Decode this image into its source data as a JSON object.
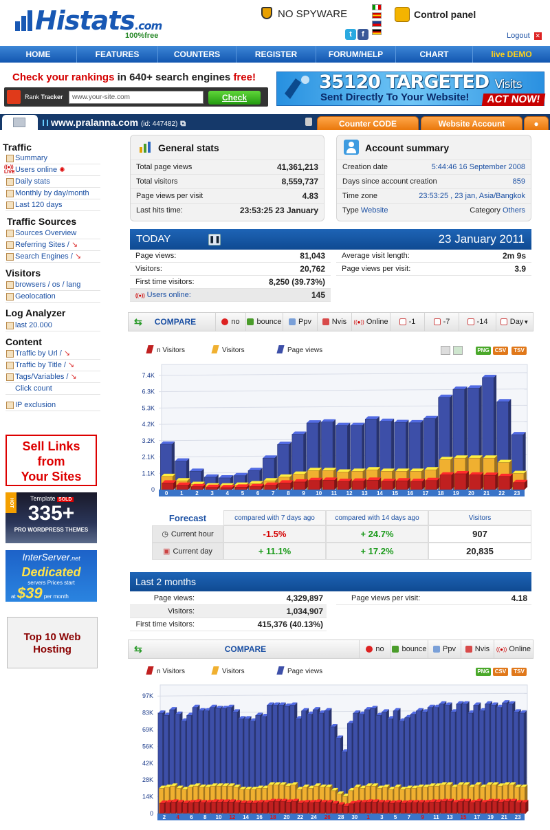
{
  "header": {
    "logo_text": "Histats",
    "logo_suffix": ".com",
    "logo_tagline": "100%free",
    "nospyware": "NO SPYWARE",
    "control_panel": "Control panel",
    "logout": "Logout"
  },
  "nav": [
    "HOME",
    "FEATURES",
    "COUNTERS",
    "REGISTER",
    "FORUM/HELP",
    "CHART",
    "live DEMO"
  ],
  "rank": {
    "headline_a": "Check your rankings",
    "headline_b": "in 640+ search engines",
    "headline_c": "free!",
    "label_a": "Rank",
    "label_b": "Tracker",
    "input_value": "www.your-site.com",
    "button": "Check"
  },
  "banner": {
    "line1_num": "35120 TARGETED",
    "line1_suffix": "Visits",
    "line2": "Sent Directly To Your Website!",
    "cta": "ACT NOW!"
  },
  "sitebar": {
    "site": "www.pralanna.com",
    "id_text": "(id: 447482)",
    "tab_counter": "Counter CODE",
    "tab_account": "Website Account"
  },
  "sidebar": {
    "traffic_title": "Traffic",
    "traffic_items": [
      "Summary",
      "Users online",
      "Daily stats",
      "Monthly by day/month",
      "Last 120 days"
    ],
    "sources_title": "Traffic Sources",
    "sources_items": [
      "Sources Overview",
      "Referring Sites /",
      "Search Engines /"
    ],
    "visitors_title": "Visitors",
    "visitors_items": [
      "browsers / os / lang",
      "Geolocation"
    ],
    "log_title": "Log Analyzer",
    "log_items": [
      "last 20.000"
    ],
    "content_title": "Content",
    "content_items": [
      "Traffic by Url /",
      "Traffic by Title /",
      "Tags/Variables /",
      "Click count"
    ],
    "ip_exclusion": "IP exclusion"
  },
  "ads": {
    "sell1": "Sell Links",
    "sell2": "from",
    "sell3": "Your Sites",
    "template_word": "Template",
    "sold_badge": "SOLD",
    "hot_badge": "HOT",
    "num335": "335+",
    "pro_wp": "PRO WORDPRESS THEMES",
    "interserver": "InterServer",
    "interserver_tld": ".net",
    "dedicated": "Dedicated",
    "servers_price": "servers Prices start",
    "at": "at",
    "price": "$39",
    "per_month": "per month",
    "top10a": "Top 10 Web",
    "top10b": "Hosting"
  },
  "general": {
    "title": "General stats",
    "rows": [
      {
        "label": "Total page views",
        "value": "41,361,213"
      },
      {
        "label": "Total visitors",
        "value": "8,559,737"
      },
      {
        "label": "Page views per visit",
        "value": "4.83"
      },
      {
        "label": "Last hits time:",
        "value": "23:53:25 23 January"
      }
    ]
  },
  "account": {
    "title": "Account summary",
    "creation_label": "Creation date",
    "creation_value": "5:44:46 16 September 2008",
    "days_label": "Days since account creation",
    "days_value": "859",
    "tz_label": "Time zone",
    "tz_value": "23:53:25 , 23 jan, Asia/Bangkok",
    "type_label": "Type",
    "type_value": "Website",
    "cat_label": "Category",
    "cat_value": "Others"
  },
  "today": {
    "title": "TODAY",
    "date": "23 January 2011",
    "left": [
      {
        "label": "Page views:",
        "value": "81,043"
      },
      {
        "label": "Visitors:",
        "value": "20,762"
      },
      {
        "label": "First time visitors:",
        "value": "8,250 (39.73%)"
      },
      {
        "label": "Users online:",
        "value": "145"
      }
    ],
    "right": [
      {
        "label": "Average visit length:",
        "value": "2m 9s"
      },
      {
        "label": "Page views per visit:",
        "value": "3.9"
      }
    ]
  },
  "compare1": {
    "title": "COMPARE",
    "items": [
      "no",
      "bounce",
      "Ppv",
      "Nvis",
      "Online",
      "-1",
      "-7",
      "-14",
      "Day"
    ]
  },
  "legend": {
    "nvis": "n Visitors",
    "vis": "Visitors",
    "pv": "Page views"
  },
  "buttons": {
    "png": "PNG",
    "csv": "CSV",
    "tsv": "TSV"
  },
  "chart_data": [
    {
      "type": "bar",
      "yticks": [
        "0",
        "1.1K",
        "2.1K",
        "3.2K",
        "4.2K",
        "5.3K",
        "6.3K",
        "7.4K"
      ],
      "ylim": [
        0,
        7800
      ],
      "categories": [
        "0",
        "1",
        "2",
        "3",
        "4",
        "5",
        "6",
        "7",
        "8",
        "9",
        "10",
        "11",
        "12",
        "13",
        "14",
        "15",
        "16",
        "17",
        "18",
        "19",
        "20",
        "21",
        "22",
        "23"
      ],
      "series": [
        {
          "name": "Page views",
          "color": "#3d4fa8",
          "values": [
            3100,
            1950,
            1250,
            850,
            800,
            950,
            1300,
            2150,
            3080,
            3780,
            4550,
            4620,
            4380,
            4380,
            4820,
            4660,
            4580,
            4560,
            4850,
            6300,
            6850,
            6930,
            7650,
            6000,
            3750
          ]
        },
        {
          "name": "Visitors",
          "color": "#f0b030",
          "values": [
            900,
            600,
            350,
            250,
            250,
            300,
            400,
            600,
            850,
            1050,
            1300,
            1300,
            1200,
            1250,
            1350,
            1250,
            1250,
            1250,
            1350,
            2050,
            2150,
            2150,
            2150,
            1850,
            1100
          ]
        },
        {
          "name": "n Visitors",
          "color": "#c02020",
          "values": [
            450,
            300,
            200,
            150,
            130,
            170,
            200,
            300,
            450,
            520,
            620,
            640,
            560,
            580,
            640,
            560,
            600,
            560,
            620,
            1000,
            1080,
            1000,
            980,
            900,
            480
          ]
        }
      ]
    },
    {
      "type": "bar",
      "yticks": [
        "0",
        "14K",
        "28K",
        "42K",
        "56K",
        "69K",
        "83K",
        "97K"
      ],
      "ylim": [
        0,
        103000
      ],
      "categories": [
        "2",
        "4",
        "6",
        "8",
        "10",
        "12",
        "14",
        "16",
        "18",
        "20",
        "22",
        "24",
        "26",
        "28",
        "30",
        "1",
        "3",
        "5",
        "7",
        "9",
        "11",
        "13",
        "15",
        "17",
        "19",
        "21",
        "23"
      ],
      "red_labels": [
        "4",
        "12",
        "18",
        "26",
        "1",
        "9",
        "15"
      ],
      "series": [
        {
          "name": "Page views",
          "color": "#3d4fa8",
          "values": [
            88000,
            86000,
            91000,
            87000,
            81000,
            86000,
            93000,
            90000,
            90000,
            93000,
            92000,
            92000,
            93000,
            89000,
            83000,
            83000,
            81000,
            86000,
            85000,
            95000,
            95000,
            95000,
            94000,
            95000,
            83000,
            90000,
            87000,
            91000,
            88000,
            90000,
            76000,
            66000,
            54000,
            79000,
            88000,
            87000,
            91000,
            92000,
            86000,
            89000,
            83000,
            90000,
            81000,
            84000,
            87000,
            90000,
            89000,
            93000,
            93000,
            96000,
            95000,
            89000,
            96000,
            96000,
            88000,
            95000,
            90000,
            96000,
            95000,
            93000,
            97000,
            96000,
            89000,
            88000
          ]
        },
        {
          "name": "Visitors",
          "color": "#f0b030",
          "values": [
            22000,
            23000,
            24000,
            22000,
            21000,
            23000,
            24000,
            23000,
            23000,
            24000,
            24000,
            24000,
            24000,
            23000,
            21000,
            21000,
            21000,
            22000,
            22000,
            25000,
            25000,
            25000,
            24000,
            25000,
            21000,
            23000,
            22000,
            24000,
            23000,
            23000,
            20000,
            17000,
            15000,
            20000,
            23000,
            22000,
            24000,
            24000,
            22000,
            23000,
            21000,
            23000,
            21000,
            22000,
            22000,
            23000,
            23000,
            24000,
            24000,
            25000,
            25000,
            23000,
            25000,
            25000,
            23000,
            25000,
            23000,
            25000,
            25000,
            24000,
            25000,
            25000,
            23000,
            23000
          ]
        },
        {
          "name": "n Visitors",
          "color": "#c02020",
          "values": [
            9000,
            9500,
            10000,
            9500,
            9000,
            9500,
            10000,
            9500,
            9500,
            10000,
            10000,
            10000,
            10000,
            9500,
            9000,
            9000,
            9000,
            9500,
            9500,
            10500,
            10500,
            10500,
            10000,
            10500,
            9000,
            9500,
            9500,
            10000,
            9500,
            9500,
            8500,
            7500,
            6500,
            8500,
            9500,
            9500,
            10000,
            10000,
            9500,
            9500,
            9000,
            9500,
            9000,
            9500,
            9500,
            9500,
            9500,
            10000,
            10000,
            10500,
            10500,
            9500,
            10500,
            10500,
            9500,
            10500,
            9500,
            10500,
            10500,
            10000,
            10500,
            10500,
            9500,
            9500
          ]
        }
      ]
    }
  ],
  "forecast": {
    "title": "Forecast",
    "h1": "compared with 7 days ago",
    "h2": "compared with 14 days ago",
    "h3": "Visitors",
    "r1_label": "Current hour",
    "r1_c1": "-1.5%",
    "r1_c2": "+ 24.7%",
    "r1_c3": "907",
    "r2_label": "Current day",
    "r2_c1": "+ 11.1%",
    "r2_c2": "+ 17.2%",
    "r2_c3": "20,835"
  },
  "last2": {
    "title": "Last 2 months",
    "rows": [
      {
        "label": "Page views:",
        "value": "4,329,897"
      },
      {
        "label": "Visitors:",
        "value": "1,034,907"
      },
      {
        "label": "First time visitors:",
        "value": "415,376 (40.13%)"
      }
    ],
    "ppv_label": "Page views per visit:",
    "ppv_value": "4.18"
  },
  "compare2": {
    "title": "COMPARE",
    "items": [
      "no",
      "bounce",
      "Ppv",
      "Nvis",
      "Online"
    ]
  }
}
